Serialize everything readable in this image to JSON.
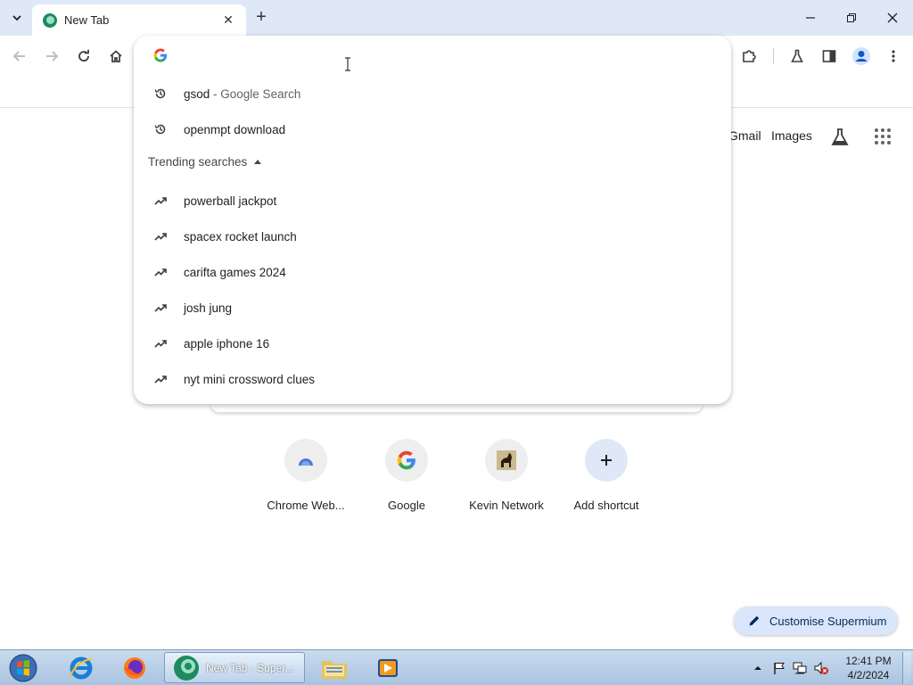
{
  "tab": {
    "title": "New Tab",
    "close_label": "✕",
    "new_tab_label": "+"
  },
  "window": {
    "minimize": "—",
    "restore": "❐",
    "close": "✕"
  },
  "ntp": {
    "gmail": "Gmail",
    "images": "Images"
  },
  "omnibox": {
    "input_value": "",
    "history": [
      {
        "text": "gsod",
        "suffix": " - Google Search",
        "icon": "history-icon"
      },
      {
        "text": "openmpt download",
        "suffix": "",
        "icon": "history-icon"
      }
    ],
    "trending_header": "Trending searches",
    "trending": [
      {
        "text": "powerball jackpot",
        "icon": "trending-icon"
      },
      {
        "text": "spacex rocket launch",
        "icon": "trending-icon"
      },
      {
        "text": "carifta games 2024",
        "icon": "trending-icon"
      },
      {
        "text": "josh jung",
        "icon": "trending-icon"
      },
      {
        "text": "apple iphone 16",
        "icon": "trending-icon"
      },
      {
        "text": "nyt mini crossword clues",
        "icon": "trending-icon"
      }
    ]
  },
  "shortcuts": [
    {
      "label": "Chrome Web...",
      "icon": "chrome-web-store-icon"
    },
    {
      "label": "Google",
      "icon": "google-icon"
    },
    {
      "label": "Kevin Network",
      "icon": "horse-icon"
    },
    {
      "label": "Add shortcut",
      "icon": "plus-icon"
    }
  ],
  "customise": {
    "label": "Customise Supermium",
    "icon": "pencil-icon"
  },
  "taskbar": {
    "active_app_label": "New Tab - Super...",
    "time": "12:41 PM",
    "date": "4/2/2024"
  },
  "colors": {
    "accent": "#0b57d0",
    "tabstrip": "#dfe8f7",
    "customise_bg": "#d9e6fb"
  }
}
